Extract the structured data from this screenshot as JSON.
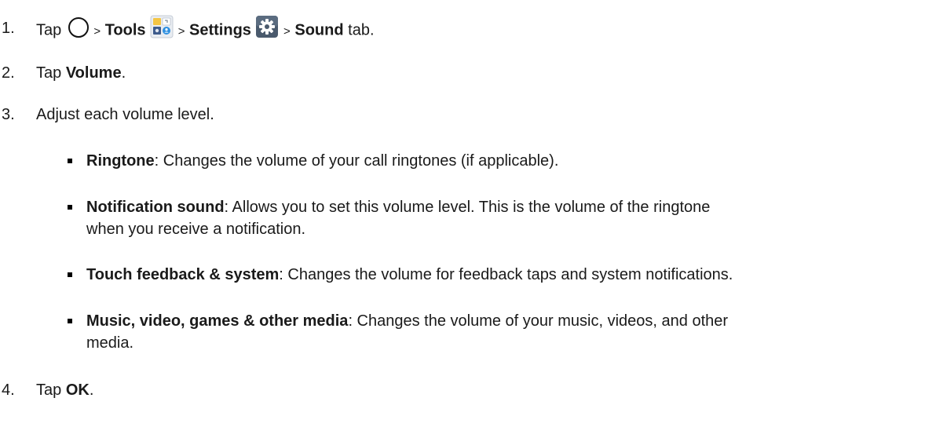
{
  "steps": [
    {
      "num": "1.",
      "parts": {
        "tap": "Tap",
        "sep": ">",
        "tools": "Tools",
        "settings": "Settings",
        "sound": "Sound",
        "tab": "tab."
      }
    },
    {
      "num": "2.",
      "tap": "Tap",
      "target": "Volume",
      "end": "."
    },
    {
      "num": "3.",
      "text": "Adjust each volume level."
    },
    {
      "num": "4.",
      "tap": "Tap",
      "target": "OK",
      "end": "."
    }
  ],
  "bullets": [
    {
      "term": "Ringtone",
      "desc": ": Changes the volume of your call ringtones (if applicable).",
      "cont": ""
    },
    {
      "term": "Notification sound",
      "desc": ": Allows you to set this volume level. This is the volume of the ringtone",
      "cont": "when you receive a notification."
    },
    {
      "term": "Touch feedback & system",
      "desc": ": Changes the volume for feedback taps and system notifications.",
      "cont": ""
    },
    {
      "term": "Music, video, games & other media",
      "desc": ": Changes the volume of your music, videos, and other",
      "cont": "media."
    }
  ],
  "icons": {
    "home": "home-button-icon",
    "tools": "tools-folder-icon",
    "settings": "settings-gear-icon"
  }
}
